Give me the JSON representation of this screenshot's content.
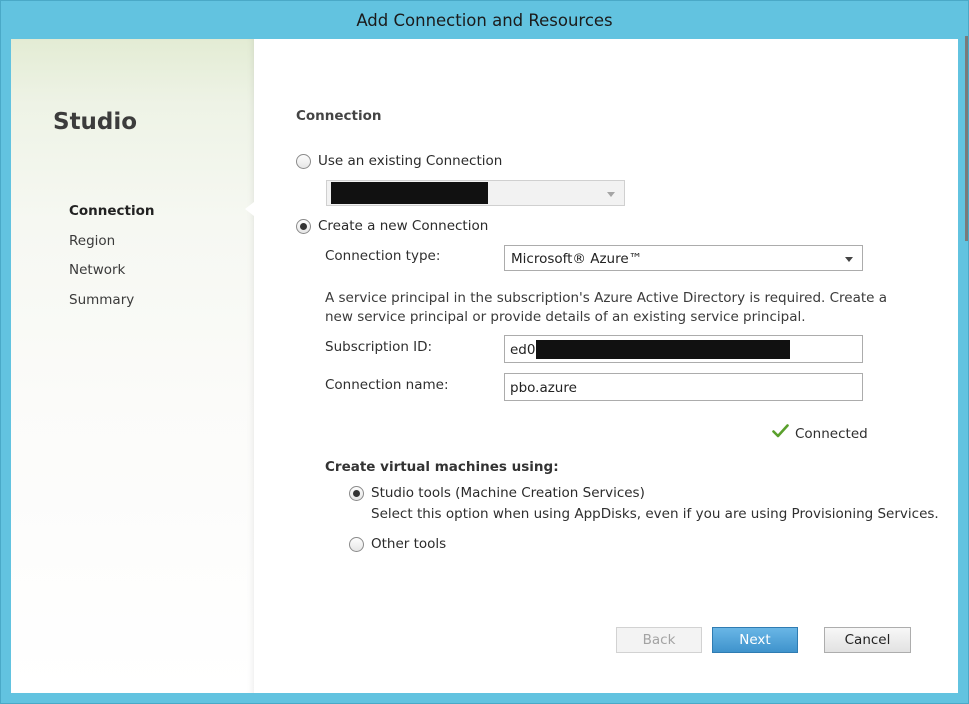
{
  "window": {
    "title": "Add Connection and Resources"
  },
  "sidebar": {
    "brand": "Studio",
    "items": [
      {
        "label": "Connection",
        "active": true
      },
      {
        "label": "Region",
        "active": false
      },
      {
        "label": "Network",
        "active": false
      },
      {
        "label": "Summary",
        "active": false
      }
    ]
  },
  "main": {
    "section_title": "Connection",
    "use_existing": {
      "label": "Use an existing Connection",
      "checked": false,
      "value": ""
    },
    "create_new": {
      "label": "Create a new Connection",
      "checked": true
    },
    "connection_type": {
      "label": "Connection type:",
      "value": "Microsoft® Azure™"
    },
    "description": "A service principal in the subscription's Azure Active Directory is required. Create a new service principal or provide details of an existing service principal.",
    "subscription_id": {
      "label": "Subscription ID:",
      "value": "ed03"
    },
    "connection_name": {
      "label": "Connection name:",
      "value": "pbo.azure"
    },
    "status": {
      "text": "Connected",
      "color": "#5aa02c"
    },
    "vm_section": {
      "title": "Create virtual machines using:",
      "options": [
        {
          "label": "Studio tools (Machine Creation Services)",
          "checked": true,
          "hint": "Select this option when using AppDisks, even if you are using Provisioning Services."
        },
        {
          "label": "Other tools",
          "checked": false
        }
      ]
    }
  },
  "buttons": {
    "back": "Back",
    "next": "Next",
    "cancel": "Cancel"
  },
  "colors": {
    "titlebar": "#62c3e0",
    "primary_button": "#4a9fd6",
    "accent_check": "#5aa02c"
  }
}
